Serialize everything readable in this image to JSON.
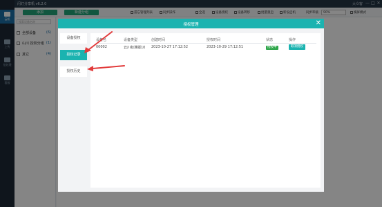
{
  "app": {
    "title": "闪灯分享机 v6.2.0",
    "user": "大众客",
    "window_controls": [
      "—",
      "□",
      "✕"
    ]
  },
  "sidebar": {
    "items": [
      {
        "label": "云机",
        "icon": "cloud-phone-icon",
        "active": true
      },
      {
        "label": "上传",
        "icon": "upload-icon",
        "active": false
      },
      {
        "label": "批处理",
        "icon": "batch-icon",
        "active": false
      },
      {
        "label": "客服",
        "icon": "support-icon",
        "active": false
      }
    ]
  },
  "toolbar": {
    "btn_add": "添加",
    "btn_new_group": "新建分组",
    "items": [
      "遗忘管理列表",
      "同步操作",
      "全选",
      "设备授权",
      "设备转移",
      "批量重启",
      "新设启机"
    ],
    "sort_label": "同步率级",
    "sort_value": "90%",
    "mode_label": "横屏模式"
  },
  "device_panel": {
    "search_placeholder": "搜索设备名称",
    "groups": [
      {
        "label": "全部设备",
        "count": "(6)"
      },
      {
        "label": "山川  授权分组",
        "count": "(1)"
      },
      {
        "label": "其它",
        "count": "(4)"
      }
    ]
  },
  "modal": {
    "title": "授权管理",
    "close": "✕",
    "tabs": [
      {
        "label": "设备授权",
        "active": false
      },
      {
        "label": "授权记录",
        "active": true
      },
      {
        "label": "授权历史",
        "active": false
      }
    ],
    "table": {
      "headers": [
        "设备名",
        "设备类型",
        "创建时间",
        "授权时间",
        "状态",
        "操作"
      ],
      "rows": [
        {
          "device": "00002",
          "type": "云川标准版10",
          "created": "2023-10-27 17:12:52",
          "auth_time": "2023-10-29 17:12:51",
          "status": "授权中",
          "action": "取消授权"
        }
      ]
    }
  },
  "colors": {
    "accent": "#1bb3b0",
    "status_green": "#2fa64b",
    "arrow_red": "#e23b3b",
    "sidebar_bg": "#1e2a36"
  }
}
